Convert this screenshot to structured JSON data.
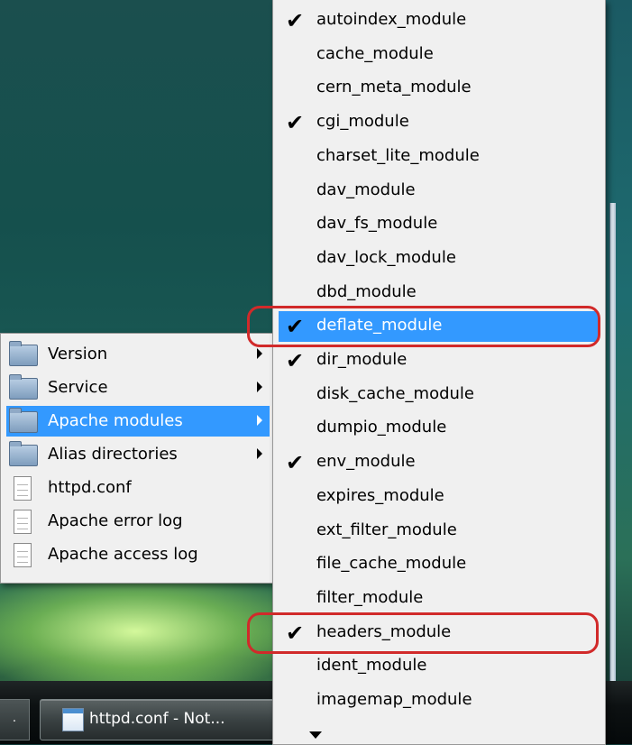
{
  "taskbar": {
    "left_button_label": ".",
    "task_label": "httpd.conf - Not...",
    "task_icon": "notepad-icon"
  },
  "main_menu": {
    "items": [
      {
        "label": "Version",
        "icon": "folder-icon",
        "submenu": true
      },
      {
        "label": "Service",
        "icon": "folder-icon",
        "submenu": true
      },
      {
        "label": "Apache modules",
        "icon": "folder-icon",
        "submenu": true,
        "highlighted": true
      },
      {
        "label": "Alias directories",
        "icon": "folder-icon",
        "submenu": true
      },
      {
        "label": "httpd.conf",
        "icon": "file-icon",
        "submenu": false
      },
      {
        "label": "Apache error log",
        "icon": "file-icon",
        "submenu": false
      },
      {
        "label": "Apache access log",
        "icon": "file-icon",
        "submenu": false
      }
    ]
  },
  "modules_menu": {
    "check_glyph": "✔",
    "items": [
      {
        "label": "autoindex_module",
        "checked": true
      },
      {
        "label": "cache_module",
        "checked": false
      },
      {
        "label": "cern_meta_module",
        "checked": false
      },
      {
        "label": "cgi_module",
        "checked": true
      },
      {
        "label": "charset_lite_module",
        "checked": false
      },
      {
        "label": "dav_module",
        "checked": false
      },
      {
        "label": "dav_fs_module",
        "checked": false
      },
      {
        "label": "dav_lock_module",
        "checked": false
      },
      {
        "label": "dbd_module",
        "checked": false
      },
      {
        "label": "deflate_module",
        "checked": true,
        "highlighted": true,
        "circled": true
      },
      {
        "label": "dir_module",
        "checked": true
      },
      {
        "label": "disk_cache_module",
        "checked": false
      },
      {
        "label": "dumpio_module",
        "checked": false
      },
      {
        "label": "env_module",
        "checked": true
      },
      {
        "label": "expires_module",
        "checked": false
      },
      {
        "label": "ext_filter_module",
        "checked": false
      },
      {
        "label": "file_cache_module",
        "checked": false
      },
      {
        "label": "filter_module",
        "checked": false
      },
      {
        "label": "headers_module",
        "checked": true,
        "circled": true
      },
      {
        "label": "ident_module",
        "checked": false
      },
      {
        "label": "imagemap_module",
        "checked": false
      }
    ]
  },
  "colors": {
    "highlight": "#3399ff",
    "annotation": "#d12a2a",
    "menu_bg": "#f0f0f0"
  }
}
